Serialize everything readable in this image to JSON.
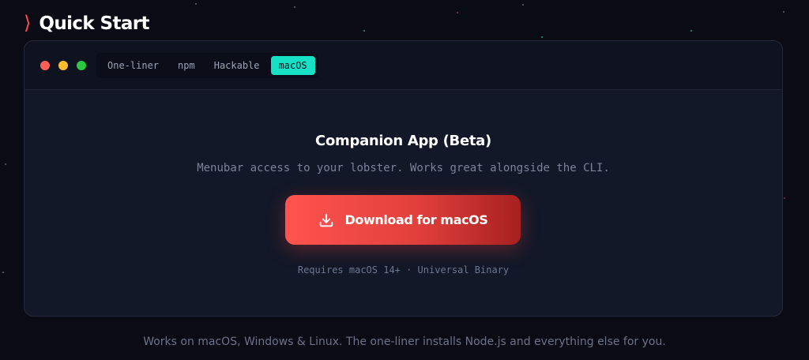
{
  "section": {
    "chevron": "⟩",
    "title": "Quick Start"
  },
  "window_controls": {
    "close_color": "#ff5f57",
    "minimize_color": "#febc2e",
    "maximize_color": "#28c840"
  },
  "tabs": [
    {
      "label": "One-liner",
      "active": false
    },
    {
      "label": "npm",
      "active": false
    },
    {
      "label": "Hackable",
      "active": false
    },
    {
      "label": "macOS",
      "active": true
    }
  ],
  "companion": {
    "title": "Companion App (Beta)",
    "subtitle": "Menubar access to your lobster. Works great alongside the CLI.",
    "download_label": "Download for macOS",
    "download_icon": "download-icon",
    "requirements": "Requires macOS 14+ · Universal Binary"
  },
  "footer": {
    "note": "Works on macOS, Windows & Linux. The one-liner installs Node.js and everything else for you."
  },
  "colors": {
    "accent_teal": "#16e1c5",
    "accent_red": "#ff4d4d",
    "background": "#0a0b14"
  }
}
